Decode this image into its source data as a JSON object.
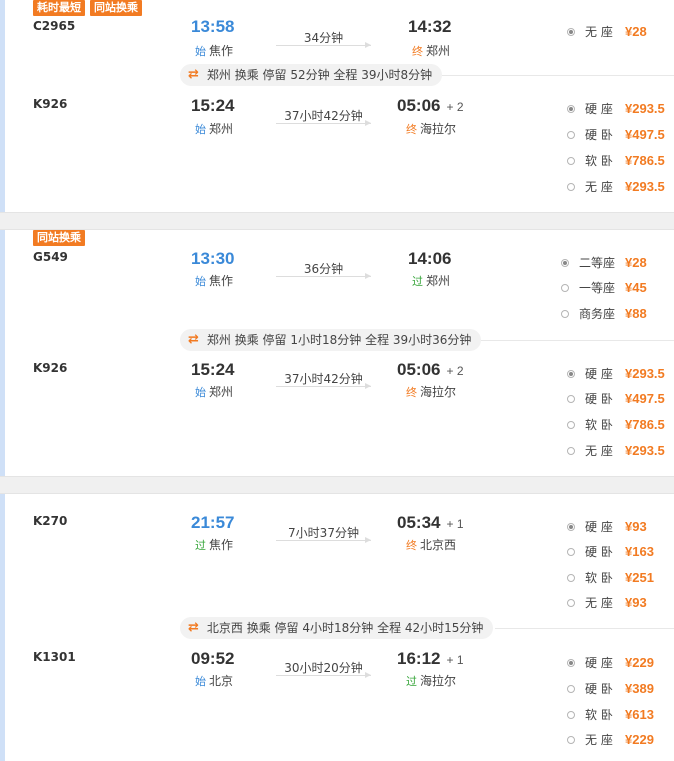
{
  "groups": [
    {
      "tags": [
        "耗时最短",
        "同站换乘"
      ],
      "legs": [
        {
          "train": "C2965",
          "dep_time": "13:58",
          "dep_badge": "始",
          "dep_station": "焦作",
          "duration": "34分钟",
          "arr_time": "14:32",
          "arr_plus": "",
          "arr_badge": "终",
          "arr_station": "郑州",
          "seats": [
            {
              "name": "无 座",
              "price": "¥28",
              "selected": true
            }
          ]
        },
        {
          "train": "K926",
          "dep_time": "15:24",
          "dep_badge": "始",
          "dep_station": "郑州",
          "duration": "37小时42分钟",
          "arr_time": "05:06",
          "arr_plus": "+ 2",
          "arr_badge": "终",
          "arr_station": "海拉尔",
          "seats": [
            {
              "name": "硬 座",
              "price": "¥293.5",
              "selected": true
            },
            {
              "name": "硬 卧",
              "price": "¥497.5",
              "selected": false
            },
            {
              "name": "软 卧",
              "price": "¥786.5",
              "selected": false
            },
            {
              "name": "无 座",
              "price": "¥293.5",
              "selected": false
            }
          ]
        }
      ],
      "transfer": "郑州 换乘 停留 52分钟 全程 39小时8分钟"
    },
    {
      "tags": [
        "同站换乘"
      ],
      "legs": [
        {
          "train": "G549",
          "dep_time": "13:30",
          "dep_badge": "始",
          "dep_station": "焦作",
          "duration": "36分钟",
          "arr_time": "14:06",
          "arr_plus": "",
          "arr_badge": "过",
          "arr_station": "郑州",
          "seats": [
            {
              "name": "二等座",
              "price": "¥28",
              "selected": true
            },
            {
              "name": "一等座",
              "price": "¥45",
              "selected": false
            },
            {
              "name": "商务座",
              "price": "¥88",
              "selected": false
            }
          ]
        },
        {
          "train": "K926",
          "dep_time": "15:24",
          "dep_badge": "始",
          "dep_station": "郑州",
          "duration": "37小时42分钟",
          "arr_time": "05:06",
          "arr_plus": "+ 2",
          "arr_badge": "终",
          "arr_station": "海拉尔",
          "seats": [
            {
              "name": "硬 座",
              "price": "¥293.5",
              "selected": true
            },
            {
              "name": "硬 卧",
              "price": "¥497.5",
              "selected": false
            },
            {
              "name": "软 卧",
              "price": "¥786.5",
              "selected": false
            },
            {
              "name": "无 座",
              "price": "¥293.5",
              "selected": false
            }
          ]
        }
      ],
      "transfer": "郑州 换乘 停留 1小时18分钟 全程 39小时36分钟"
    },
    {
      "tags": [],
      "legs": [
        {
          "train": "K270",
          "dep_time": "21:57",
          "dep_badge": "过",
          "dep_station": "焦作",
          "duration": "7小时37分钟",
          "arr_time": "05:34",
          "arr_plus": "+ 1",
          "arr_badge": "终",
          "arr_station": "北京西",
          "seats": [
            {
              "name": "硬 座",
              "price": "¥93",
              "selected": true
            },
            {
              "name": "硬 卧",
              "price": "¥163",
              "selected": false
            },
            {
              "name": "软 卧",
              "price": "¥251",
              "selected": false
            },
            {
              "name": "无 座",
              "price": "¥93",
              "selected": false
            }
          ]
        },
        {
          "train": "K1301",
          "dep_time": "09:52",
          "dep_badge": "始",
          "dep_station": "北京",
          "duration": "30小时20分钟",
          "arr_time": "16:12",
          "arr_plus": "+ 1",
          "arr_badge": "过",
          "arr_station": "海拉尔",
          "seats": [
            {
              "name": "硬 座",
              "price": "¥229",
              "selected": true
            },
            {
              "name": "硬 卧",
              "price": "¥389",
              "selected": false
            },
            {
              "name": "软 卧",
              "price": "¥613",
              "selected": false
            },
            {
              "name": "无 座",
              "price": "¥229",
              "selected": false
            }
          ]
        }
      ],
      "transfer": "北京西 换乘 停留 4小时18分钟 全程 42小时15分钟"
    }
  ],
  "colors": {
    "accent": "#3a89d8",
    "price": "#f27b22",
    "tag_bg": "#f27b22",
    "pass": "#36a53a"
  },
  "icons": {
    "transfer": "transfer-arrows-icon",
    "radio": "radio-icon"
  }
}
